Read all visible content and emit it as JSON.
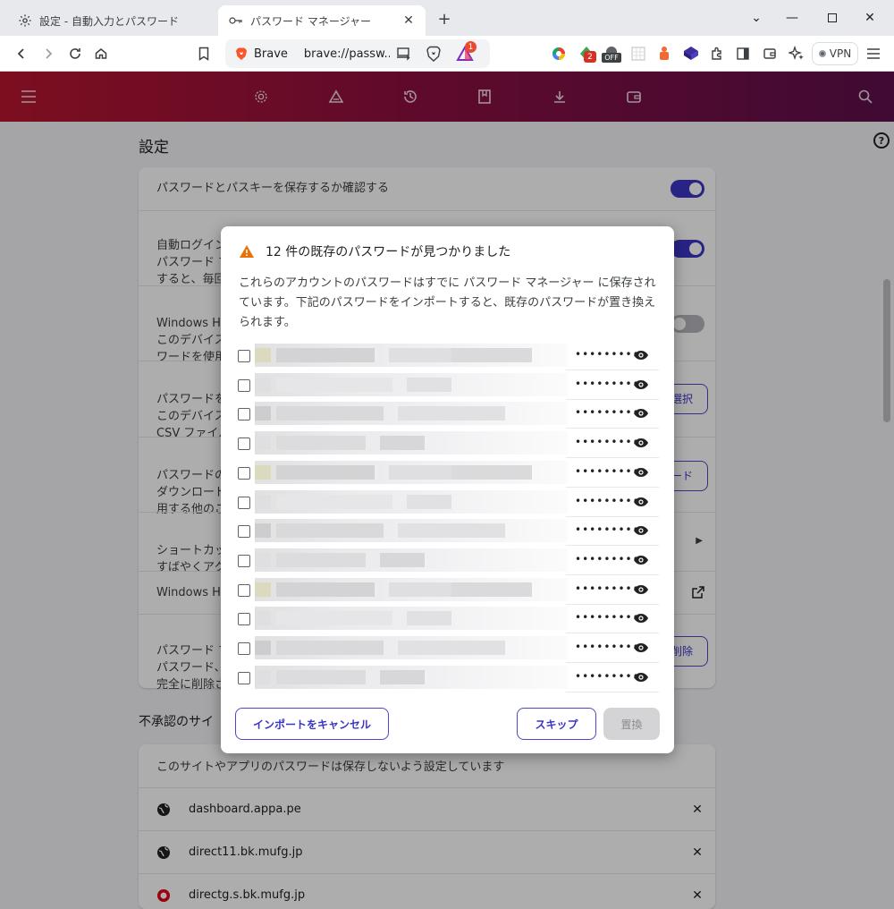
{
  "tabs": [
    {
      "title": "設定 - 自動入力とパスワード",
      "active": false
    },
    {
      "title": "パスワード マネージャー",
      "active": true
    }
  ],
  "toolbar": {
    "brand": "Brave",
    "url": "brave://passw...",
    "vpn_label": "VPN",
    "alert_badge": "1",
    "ext_badge": "2",
    "ext_off_badge": "OFF"
  },
  "settings": {
    "title": "設定",
    "help": "?",
    "rows": [
      {
        "text": "パスワードとパスキーを保存するか確認する"
      },
      {
        "text": "自動ログイン\nパスワード マ\nすると、毎回"
      },
      {
        "text": "Windows He\nこのデバイス\nワードを使用"
      },
      {
        "text": "パスワードを\nこのデバイス\nCSV ファイル",
        "button": "選択"
      },
      {
        "text": "パスワードの\nダウンロード\n用する他のこ",
        "button": "ード"
      },
      {
        "text": "ショートカッ\nすばやくアク"
      },
      {
        "text": "Windows He"
      },
      {
        "text": "パスワード マ\nパスワード、\n完全に削除さ",
        "button": "削除"
      }
    ],
    "unapproved_title": "不承認のサイ",
    "unapproved_desc": "このサイトやアプリのパスワードは保存しないよう設定しています",
    "sites": [
      "dashboard.appa.pe",
      "direct11.bk.mufg.jp",
      "directg.s.bk.mufg.jp"
    ]
  },
  "dialog": {
    "title": "12 件の既存のパスワードが見つかりました",
    "body": "これらのアカウントのパスワードはすでに パスワード マネージャー に保存されています。下記のパスワードをインポートすると、既存のパスワードが置き換えられます。",
    "password_mask": "••••••••••",
    "row_count": 12,
    "cancel_label": "インポートをキャンセル",
    "skip_label": "スキップ",
    "replace_label": "置換"
  },
  "colors": {
    "accent": "#3b35c5",
    "header_start": "#b8162f",
    "header_end": "#5e0f4d",
    "warning": "#e8710a"
  }
}
